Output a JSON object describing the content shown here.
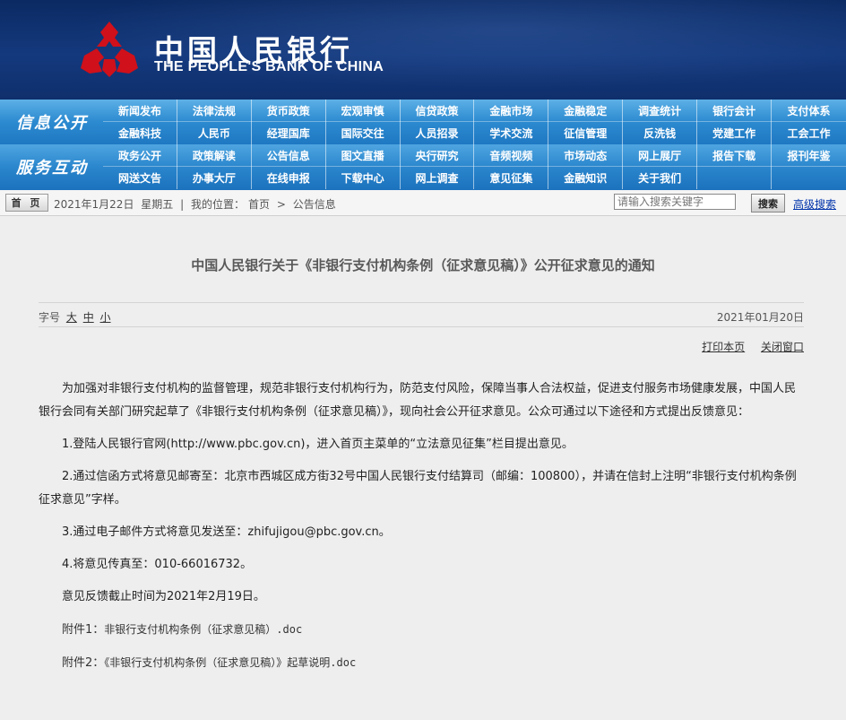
{
  "header": {
    "logo_cn": "中国人民银行",
    "logo_en": "THE PEOPLE'S BANK OF CHINA"
  },
  "nav": {
    "row1_label": "信息公开",
    "row1_items": [
      "新闻发布",
      "法律法规",
      "货币政策",
      "宏观审慎",
      "信贷政策",
      "金融市场",
      "金融稳定",
      "调查统计",
      "银行会计",
      "支付体系",
      "金融科技",
      "人民币",
      "经理国库",
      "国际交往",
      "人员招录",
      "学术交流",
      "征信管理",
      "反洗钱",
      "党建工作",
      "工会工作"
    ],
    "row2_label": "服务互动",
    "row2_items": [
      "政务公开",
      "政策解读",
      "公告信息",
      "图文直播",
      "央行研究",
      "音频视频",
      "市场动态",
      "网上展厅",
      "报告下载",
      "报刊年鉴",
      "网送文告",
      "办事大厅",
      "在线申报",
      "下载中心",
      "网上调查",
      "意见征集",
      "金融知识",
      "关于我们",
      "",
      ""
    ]
  },
  "breadbar": {
    "home_label": "首 页",
    "date": "2021年1月22日",
    "weekday": "星期五",
    "sep": "|",
    "location_label": "我的位置：",
    "crumb_home": "首页",
    "crumb_arrow": ">",
    "crumb_current": "公告信息",
    "search_placeholder": "请输入搜索关键字",
    "search_button": "搜索",
    "advanced_search": "高级搜索"
  },
  "article": {
    "title": "中国人民银行关于《非银行支付机构条例（征求意见稿）》公开征求意见的通知",
    "font_label": "字号",
    "font_large": "大",
    "font_medium": "中",
    "font_small": "小",
    "date": "2021年01月20日",
    "print_label": "打印本页",
    "close_label": "关闭窗口",
    "para1": "为加强对非银行支付机构的监督管理，规范非银行支付机构行为，防范支付风险，保障当事人合法权益，促进支付服务市场健康发展，中国人民银行会同有关部门研究起草了《非银行支付机构条例（征求意见稿）》，现向社会公开征求意见。公众可通过以下途径和方式提出反馈意见：",
    "item1": "1.登陆人民银行官网(http://www.pbc.gov.cn)，进入首页主菜单的“立法意见征集”栏目提出意见。",
    "item2": "2.通过信函方式将意见邮寄至：北京市西城区成方街32号中国人民银行支付结算司（邮编：100800），并请在信封上注明“非银行支付机构条例征求意见”字样。",
    "item3": "3.通过电子邮件方式将意见发送至：zhifujigou@pbc.gov.cn。",
    "item4": "4.将意见传真至：010-66016732。",
    "deadline": "意见反馈截止时间为2021年2月19日。",
    "attach1_label": "附件1：",
    "attach1_file": "非银行支付机构条例（征求意见稿）.doc",
    "attach2_label": "附件2：",
    "attach2_file": "《非银行支付机构条例（征求意见稿）》起草说明.doc"
  }
}
